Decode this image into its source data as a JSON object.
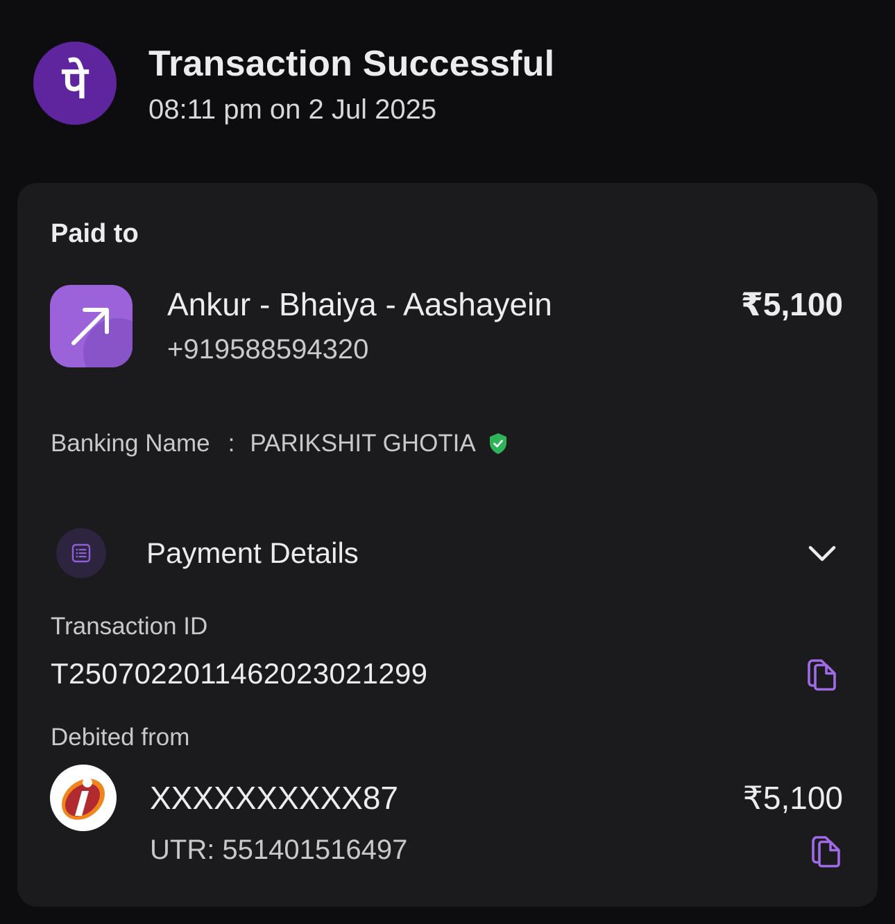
{
  "header": {
    "title": "Transaction Successful",
    "timestamp": "08:11 pm on 2 Jul 2025",
    "brand_logo_glyph": "पे",
    "brand_color": "#5f259f"
  },
  "paid_to": {
    "label": "Paid to",
    "name": "Ankur - Bhaiya - Aashayein",
    "phone": "+919588594320",
    "amount": "₹5,100",
    "icon": "arrow-up-right-icon",
    "icon_color": "#9b62d9"
  },
  "banking": {
    "label": "Banking Name",
    "separator": ":",
    "value": "PARIKSHIT GHOTIA",
    "verified_icon": "verified-shield-icon",
    "verified_color": "#2fb35a"
  },
  "payment_details": {
    "title": "Payment Details",
    "icon": "receipt-list-icon",
    "toggle_icon": "chevron-down-icon",
    "transaction_id_label": "Transaction ID",
    "transaction_id": "T2507022011462023021299",
    "debited_from_label": "Debited from",
    "account": "XXXXXXXXXX87",
    "utr": "UTR: 551401516497",
    "debit_amount": "₹5,100",
    "bank_logo": "icici-bank-logo",
    "copy_icon": "copy-icon",
    "accent_color": "#a06be6"
  }
}
